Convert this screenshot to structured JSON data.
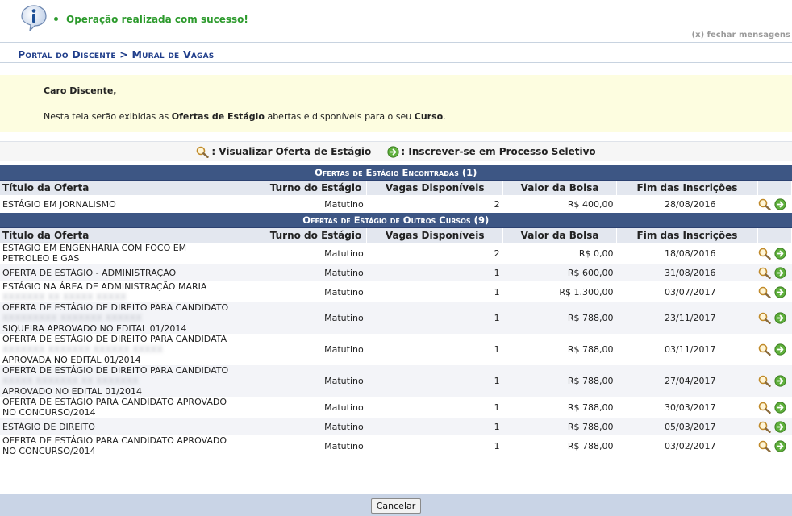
{
  "message": {
    "text": "Operação realizada com sucesso!",
    "close_label": "(x) fechar mensagens",
    "icon": "info-icon"
  },
  "breadcrumb": "Portal do Discente > Mural de Vagas",
  "intro": {
    "greeting": "Caro Discente,",
    "desc_prefix": "Nesta tela serão exibidas as ",
    "desc_bold1": "Ofertas de Estágio",
    "desc_mid": " abertas e disponíveis para o seu ",
    "desc_bold2": "Curso",
    "desc_suffix": "."
  },
  "legend": {
    "view_label": ": Visualizar Oferta de Estágio",
    "apply_label": ": Inscrever-se em Processo Seletivo"
  },
  "columns": [
    "Título da Oferta",
    "Turno do Estágio",
    "Vagas Disponíveis",
    "Valor da Bolsa",
    "Fim das Inscrições"
  ],
  "section1": {
    "caption": "Ofertas de Estágio Encontradas (1)",
    "rows": [
      {
        "title": "ESTÁGIO EM JORNALISMO",
        "hidden": "",
        "title2": "",
        "turno": "Matutino",
        "vagas": "2",
        "valor": "R$ 400,00",
        "fim": "28/08/2016"
      }
    ]
  },
  "section2": {
    "caption": "Ofertas de Estágio de Outros Cursos (9)",
    "rows": [
      {
        "title": "ESTAGIO EM ENGENHARIA COM FOCO EM PETROLEO E GAS",
        "hidden": "",
        "title2": "",
        "turno": "Matutino",
        "vagas": "2",
        "valor": "R$ 0,00",
        "fim": "18/08/2016"
      },
      {
        "title": "OFERTA DE ESTÁGIO - ADMINISTRAÇÃO",
        "hidden": "",
        "title2": "",
        "turno": "Matutino",
        "vagas": "1",
        "valor": "R$ 600,00",
        "fim": "31/08/2016"
      },
      {
        "title": "ESTÁGIO NA ÁREA DE ADMINISTRAÇÃO MARIA",
        "hidden": "XXXXXXX XX XXXXX XXXXX",
        "title2": "",
        "turno": "Matutino",
        "vagas": "1",
        "valor": "R$ 1.300,00",
        "fim": "03/07/2017"
      },
      {
        "title": "OFERTA DE ESTÁGIO DE DIREITO PARA CANDIDATO",
        "hidden": "XXXXXXXXX XXXXXXX XXXXXX",
        "title2": "SIQUEIRA APROVADO NO EDITAL 01/2014",
        "turno": "Matutino",
        "vagas": "1",
        "valor": "R$ 788,00",
        "fim": "23/11/2017"
      },
      {
        "title": "OFERTA DE ESTÁGIO DE DIREITO PARA CANDIDATA",
        "hidden": "XXXXXXX XXXXXXX XXXXXX XXXXX",
        "title2": "APROVADA NO EDITAL 01/2014",
        "turno": "Matutino",
        "vagas": "1",
        "valor": "R$ 788,00",
        "fim": "03/11/2017"
      },
      {
        "title": "OFERTA DE ESTÁGIO DE DIREITO PARA CANDIDATO",
        "hidden": "XXXXX XXXXXXX XX XXXXXXX",
        "title2": "APROVADO NO EDITAL 01/2014",
        "turno": "Matutino",
        "vagas": "1",
        "valor": "R$ 788,00",
        "fim": "27/04/2017"
      },
      {
        "title": "OFERTA DE ESTÁGIO PARA CANDIDATO APROVADO NO CONCURSO/2014",
        "hidden": "",
        "title2": "",
        "turno": "Matutino",
        "vagas": "1",
        "valor": "R$ 788,00",
        "fim": "30/03/2017"
      },
      {
        "title": "ESTÁGIO DE DIREITO",
        "hidden": "",
        "title2": "",
        "turno": "Matutino",
        "vagas": "1",
        "valor": "R$ 788,00",
        "fim": "05/03/2017"
      },
      {
        "title": "OFERTA DE ESTÁGIO PARA CANDIDATO APROVADO NO CONCURSO/2014",
        "hidden": "",
        "title2": "",
        "turno": "Matutino",
        "vagas": "1",
        "valor": "R$ 788,00",
        "fim": "03/02/2017"
      }
    ]
  },
  "footer": {
    "cancel_label": "Cancelar"
  },
  "colors": {
    "caption_bg": "#3d5684",
    "success": "#2c9a2c",
    "breadcrumb": "#1f3d8a",
    "intro_bg": "#fdfde0"
  }
}
